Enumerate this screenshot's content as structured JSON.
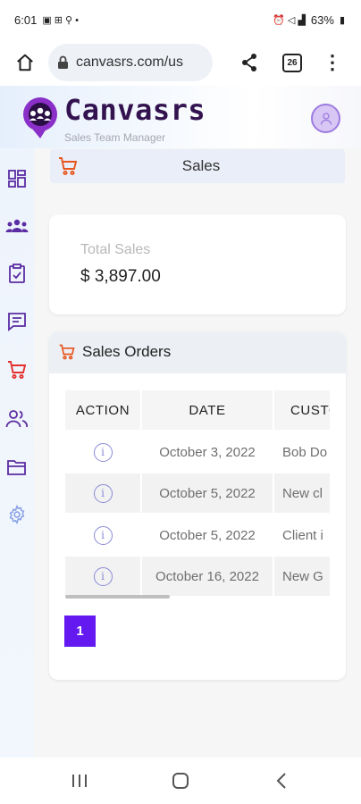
{
  "status_bar": {
    "time": "6:01",
    "battery": "63%"
  },
  "browser": {
    "url": "canvasrs.com/us",
    "tab_count": "26"
  },
  "app": {
    "brand": "Canvasrs",
    "tagline": "Sales Team Manager"
  },
  "page": {
    "title": "Sales"
  },
  "total_sales": {
    "label": "Total Sales",
    "value": "$ 3,897.00"
  },
  "orders": {
    "title": "Sales Orders",
    "columns": [
      "ACTION",
      "DATE",
      "CUSTO"
    ],
    "rows": [
      {
        "date": "October 3, 2022",
        "customer": "Bob Do"
      },
      {
        "date": "October 5, 2022",
        "customer": "New cl"
      },
      {
        "date": "October 5, 2022",
        "customer": "Client i"
      },
      {
        "date": "October 16, 2022",
        "customer": "New G"
      }
    ],
    "current_page": "1"
  },
  "colors": {
    "accent": "#6319f0",
    "brand": "#32124f",
    "sidebar_icon": "#5b2ca3",
    "cart": "#e8551f"
  }
}
